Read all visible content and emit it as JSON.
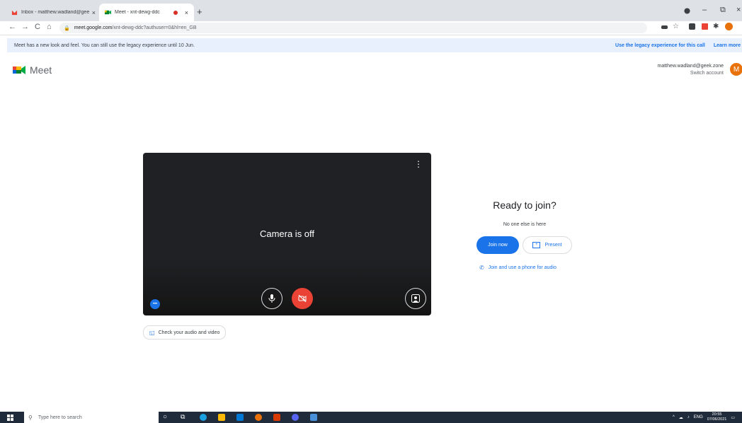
{
  "browser": {
    "tabs": [
      {
        "title": "Inbox - matthew.wadland@geek.zone",
        "close": "×"
      },
      {
        "title": "Meet - xnt-dewg-ddc",
        "close": "×"
      }
    ],
    "new_tab": "+",
    "window_controls": {
      "minimize": "–",
      "maximize": "⧉",
      "close": "×"
    },
    "url_host": "meet.google.com",
    "url_path": "/xnt-dewg-ddc?authuser=0&hl=en_GB",
    "nav": {
      "back": "←",
      "forward": "→",
      "reload": "C",
      "home": "⌂"
    }
  },
  "banner": {
    "message": "Meet has a new look and feel. You can still use the legacy experience until 10 Jun.",
    "legacy_link": "Use the legacy experience for this call",
    "learn_more": "Learn more"
  },
  "header": {
    "app_name": "Meet",
    "account_email": "matthew.wadland@geek.zone",
    "switch_account": "Switch account",
    "avatar_letter": "M"
  },
  "preview": {
    "camera_status": "Camera is off",
    "more_options": "⋮",
    "effects_label": "•••",
    "check_audio_video": "Check your audio and video"
  },
  "join": {
    "title": "Ready to join?",
    "subtitle": "No one else is here",
    "join_now": "Join now",
    "present": "Present",
    "phone_audio": "Join and use a phone for audio"
  },
  "taskbar": {
    "search_placeholder": "Type here to search",
    "language": "ENG",
    "time": "20:55",
    "date": "07/06/2021"
  },
  "colors": {
    "accent": "#1a73e8",
    "banner_bg": "#e8f0fe",
    "preview_bg": "#202124",
    "mic_off_red": "#ea4335",
    "avatar_orange": "#e8710a",
    "taskbar_bg": "#1f2a3a"
  }
}
